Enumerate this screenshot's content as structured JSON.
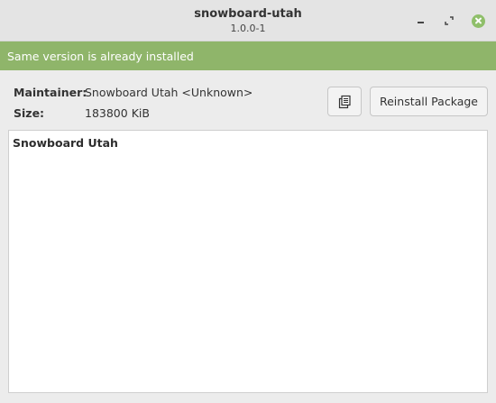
{
  "window": {
    "title": "snowboard-utah",
    "subtitle": "1.0.0-1"
  },
  "infobar": {
    "message": "Same version is already installed",
    "color": "#8fb56a"
  },
  "details": {
    "maintainer_label": "Maintainer:",
    "maintainer_value": "Snowboard Utah <Unknown>",
    "size_label": "Size:",
    "size_value": "183800 KiB"
  },
  "actions": {
    "copy_icon": "copy-icon",
    "reinstall_label": "Reinstall Package"
  },
  "description": {
    "title": "Snowboard Utah"
  },
  "colors": {
    "accent": "#8fbf6a"
  }
}
